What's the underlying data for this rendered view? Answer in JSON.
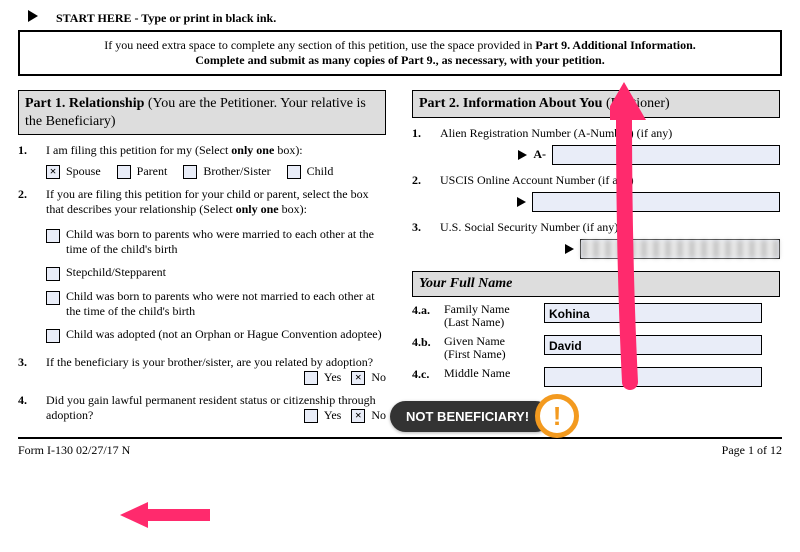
{
  "start_here": "START HERE - Type or print in black ink.",
  "instruction": {
    "line1_a": "If you need extra space to complete any section of this petition, use the space provided in ",
    "line1_b": "Part 9. Additional Information.",
    "line2_a": "Complete and submit as many copies of Part 9., as necessary, with your petition."
  },
  "part1": {
    "header_bold": "Part 1.  Relationship ",
    "header_rest": "(You are the Petitioner.  Your relative is the Beneficiary)",
    "q1": {
      "num": "1.",
      "text_a": "I am filing this petition for my (Select ",
      "text_b": "only one",
      "text_c": " box):",
      "options": [
        "Spouse",
        "Parent",
        "Brother/Sister",
        "Child"
      ],
      "checked": "Spouse"
    },
    "q2": {
      "num": "2.",
      "text_a": "If you are filing this petition for your child or parent, select the box that describes your relationship (Select ",
      "text_b": "only one",
      "text_c": " box):",
      "options": [
        "Child was born to parents who were married to each other at the time of the child's birth",
        "Stepchild/Stepparent",
        "Child was born to parents who were not married to each other at the time of the child's birth",
        "Child was adopted (not an Orphan or Hague Convention adoptee)"
      ]
    },
    "q3": {
      "num": "3.",
      "text": "If the beneficiary is your brother/sister, are you related by adoption?",
      "yes": "Yes",
      "no": "No",
      "checked": "No"
    },
    "q4": {
      "num": "4.",
      "text": "Did you gain lawful permanent resident status or citizenship through adoption?",
      "yes": "Yes",
      "no": "No",
      "checked": "No"
    }
  },
  "part2": {
    "header_bold": "Part 2.  Information About You ",
    "header_rest": "(Petitioner)",
    "f1": {
      "num": "1.",
      "label": "Alien Registration Number (A-Number) (if any)",
      "prefix": "A-",
      "value": ""
    },
    "f2": {
      "num": "2.",
      "label": "USCIS Online Account Number (if any)",
      "value": ""
    },
    "f3": {
      "num": "3.",
      "label": "U.S. Social Security Number (if any)",
      "value": ""
    },
    "name_header": "Your Full Name",
    "n4a": {
      "num": "4.a.",
      "label1": "Family Name",
      "label2": "(Last Name)",
      "value": "Kohina"
    },
    "n4b": {
      "num": "4.b.",
      "label1": "Given Name",
      "label2": "(First Name)",
      "value": "David"
    },
    "n4c": {
      "num": "4.c.",
      "label1": "Middle Name",
      "label2": "",
      "value": ""
    }
  },
  "footer": {
    "left": "Form I-130   02/27/17   N",
    "right": "Page 1 of 12"
  },
  "callout": "NOT BENEFICIARY!"
}
